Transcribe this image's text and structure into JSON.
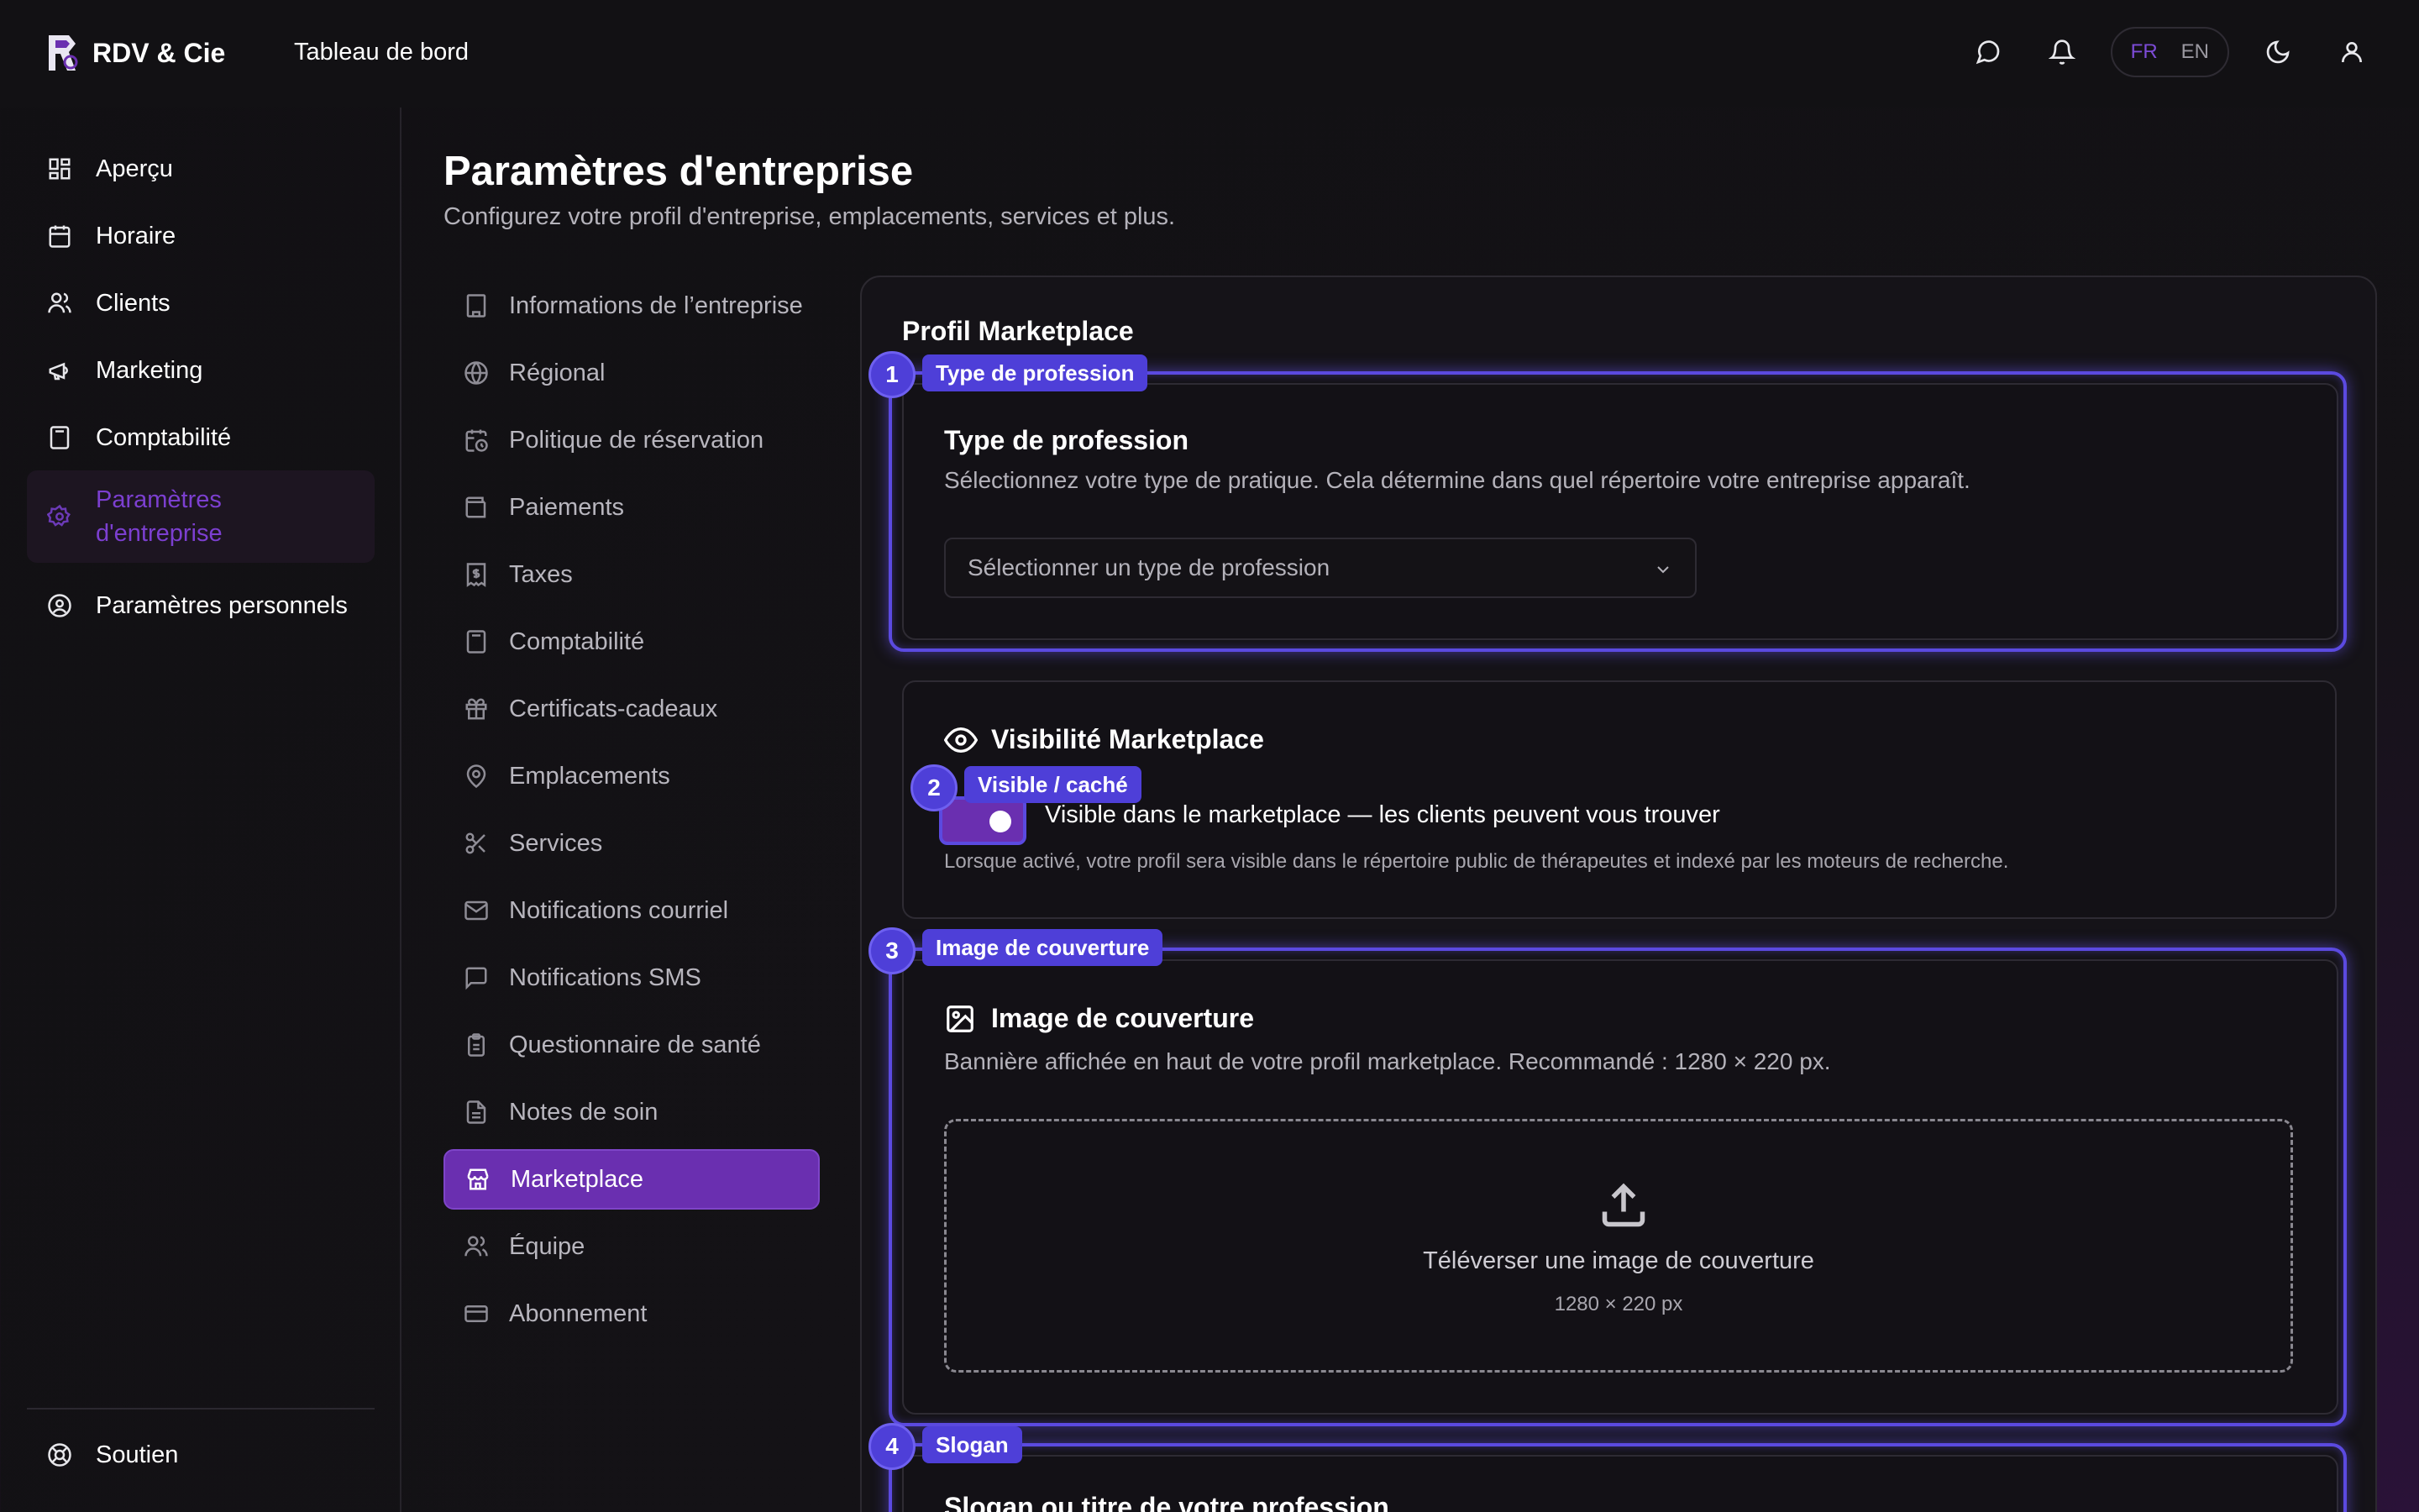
{
  "app": {
    "name": "RDV & Cie",
    "section_title": "Tableau de bord"
  },
  "topbar": {
    "lang_fr": "FR",
    "lang_en": "EN",
    "active_lang": "FR",
    "accent": "#7c4bd6"
  },
  "sidebar": {
    "items": [
      {
        "label": "Aperçu",
        "icon": "layout-grid-icon"
      },
      {
        "label": "Horaire",
        "icon": "calendar-icon"
      },
      {
        "label": "Clients",
        "icon": "users-icon"
      },
      {
        "label": "Marketing",
        "icon": "megaphone-icon"
      },
      {
        "label": "Comptabilité",
        "icon": "calculator-icon"
      },
      {
        "label": "Paramètres d'entreprise",
        "line1": "Paramètres",
        "line2": "d'entreprise",
        "icon": "gear-icon",
        "active": true
      },
      {
        "label": "Paramètres personnels",
        "icon": "user-circle-icon"
      }
    ],
    "support": "Soutien"
  },
  "page": {
    "title": "Paramètres d'entreprise",
    "subtitle": "Configurez votre profil d'entreprise, emplacements, services et plus."
  },
  "subnav": [
    {
      "label": "Informations de l’entreprise",
      "icon": "building-icon"
    },
    {
      "label": "Régional",
      "icon": "globe-icon"
    },
    {
      "label": "Politique de réservation",
      "icon": "calendar-clock-icon"
    },
    {
      "label": "Paiements",
      "icon": "wallet-icon"
    },
    {
      "label": "Taxes",
      "icon": "receipt-dollar-icon"
    },
    {
      "label": "Comptabilité",
      "icon": "calculator-icon"
    },
    {
      "label": "Certificats-cadeaux",
      "icon": "gift-icon"
    },
    {
      "label": "Emplacements",
      "icon": "map-pin-icon"
    },
    {
      "label": "Services",
      "icon": "scissors-icon"
    },
    {
      "label": "Notifications courriel",
      "icon": "mail-icon"
    },
    {
      "label": "Notifications SMS",
      "icon": "message-square-icon"
    },
    {
      "label": "Questionnaire de santé",
      "icon": "clipboard-icon"
    },
    {
      "label": "Notes de soin",
      "icon": "file-text-icon"
    },
    {
      "label": "Marketplace",
      "icon": "store-icon",
      "active": true
    },
    {
      "label": "Équipe",
      "icon": "users-icon"
    },
    {
      "label": "Abonnement",
      "icon": "credit-card-icon"
    }
  ],
  "panel": {
    "title": "Profil Marketplace",
    "profession": {
      "badge_num": "1",
      "badge_label": "Type de profession",
      "title": "Type de profession",
      "description": "Sélectionnez votre type de pratique. Cela détermine dans quel répertoire votre entreprise apparaît.",
      "select_placeholder": "Sélectionner un type de profession"
    },
    "visibility": {
      "badge_num": "2",
      "badge_label": "Visible / caché",
      "title": "Visibilité Marketplace",
      "toggle_label": "Visible dans le marketplace — les clients peuvent vous trouver",
      "toggle_on": true,
      "note": "Lorsque activé, votre profil sera visible dans le répertoire public de thérapeutes et indexé par les moteurs de recherche."
    },
    "cover": {
      "badge_num": "3",
      "badge_label": "Image de couverture",
      "title": "Image de couverture",
      "description": "Bannière affichée en haut de votre profil marketplace. Recommandé : 1280 × 220 px.",
      "upload_title": "Téléverser une image de couverture",
      "upload_size": "1280 × 220 px"
    },
    "slogan": {
      "badge_num": "4",
      "badge_label": "Slogan",
      "title": "Slogan ou titre de votre profession"
    }
  }
}
